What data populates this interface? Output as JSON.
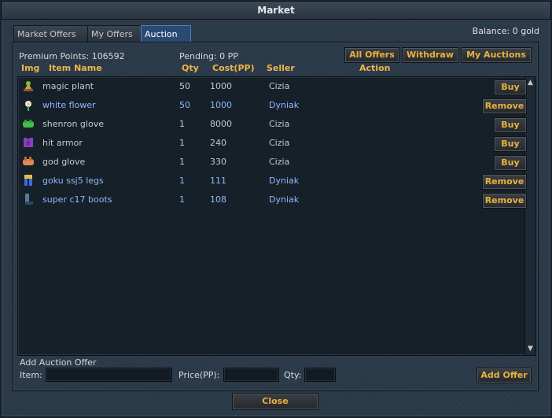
{
  "window": {
    "title": "Market"
  },
  "tabs": [
    {
      "label": "Market Offers",
      "active": false
    },
    {
      "label": "My Offers",
      "active": false
    },
    {
      "label": "Auction",
      "active": true
    }
  ],
  "balance": "Balance: 0 gold",
  "info": {
    "premium_points": "Premium Points: 106592",
    "pending": "Pending: 0 PP"
  },
  "toolbar": {
    "all_offers": "All Offers",
    "withdraw": "Withdraw",
    "my_auctions": "My Auctions"
  },
  "columns": {
    "img": "Img",
    "item_name": "Item Name",
    "qty": "Qty",
    "cost": "Cost(PP)",
    "seller": "Seller",
    "action": "Action"
  },
  "rows": [
    {
      "name": "magic plant",
      "qty": "50",
      "cost": "1000",
      "seller": "Cizia",
      "action": "Buy",
      "own": false,
      "icon": "magic-plant-icon"
    },
    {
      "name": "white flower",
      "qty": "50",
      "cost": "1000",
      "seller": "Dyniak",
      "action": "Remove",
      "own": true,
      "icon": "white-flower-icon"
    },
    {
      "name": "shenron glove",
      "qty": "1",
      "cost": "8000",
      "seller": "Cizia",
      "action": "Buy",
      "own": false,
      "icon": "glove-icon"
    },
    {
      "name": "hit armor",
      "qty": "1",
      "cost": "240",
      "seller": "Cizia",
      "action": "Buy",
      "own": false,
      "icon": "armor-icon"
    },
    {
      "name": "god glove",
      "qty": "1",
      "cost": "330",
      "seller": "Cizia",
      "action": "Buy",
      "own": false,
      "icon": "glove-icon"
    },
    {
      "name": "goku ssj5 legs",
      "qty": "1",
      "cost": "111",
      "seller": "Dyniak",
      "action": "Remove",
      "own": true,
      "icon": "legs-icon"
    },
    {
      "name": "super c17 boots",
      "qty": "1",
      "cost": "108",
      "seller": "Dyniak",
      "action": "Remove",
      "own": true,
      "icon": "boots-icon"
    }
  ],
  "add_offer": {
    "section_label": "Add Auction Offer",
    "item_label": "Item:",
    "price_label": "Price(PP):",
    "qty_label": "Qty:",
    "item_value": "",
    "price_value": "",
    "qty_value": "",
    "button": "Add Offer"
  },
  "close_button": "Close",
  "colors": {
    "accent": "#f0b34a",
    "own_row_text": "#8fb8ff",
    "other_row_text": "#c8c8c8",
    "active_tab": "#2b4a73"
  }
}
